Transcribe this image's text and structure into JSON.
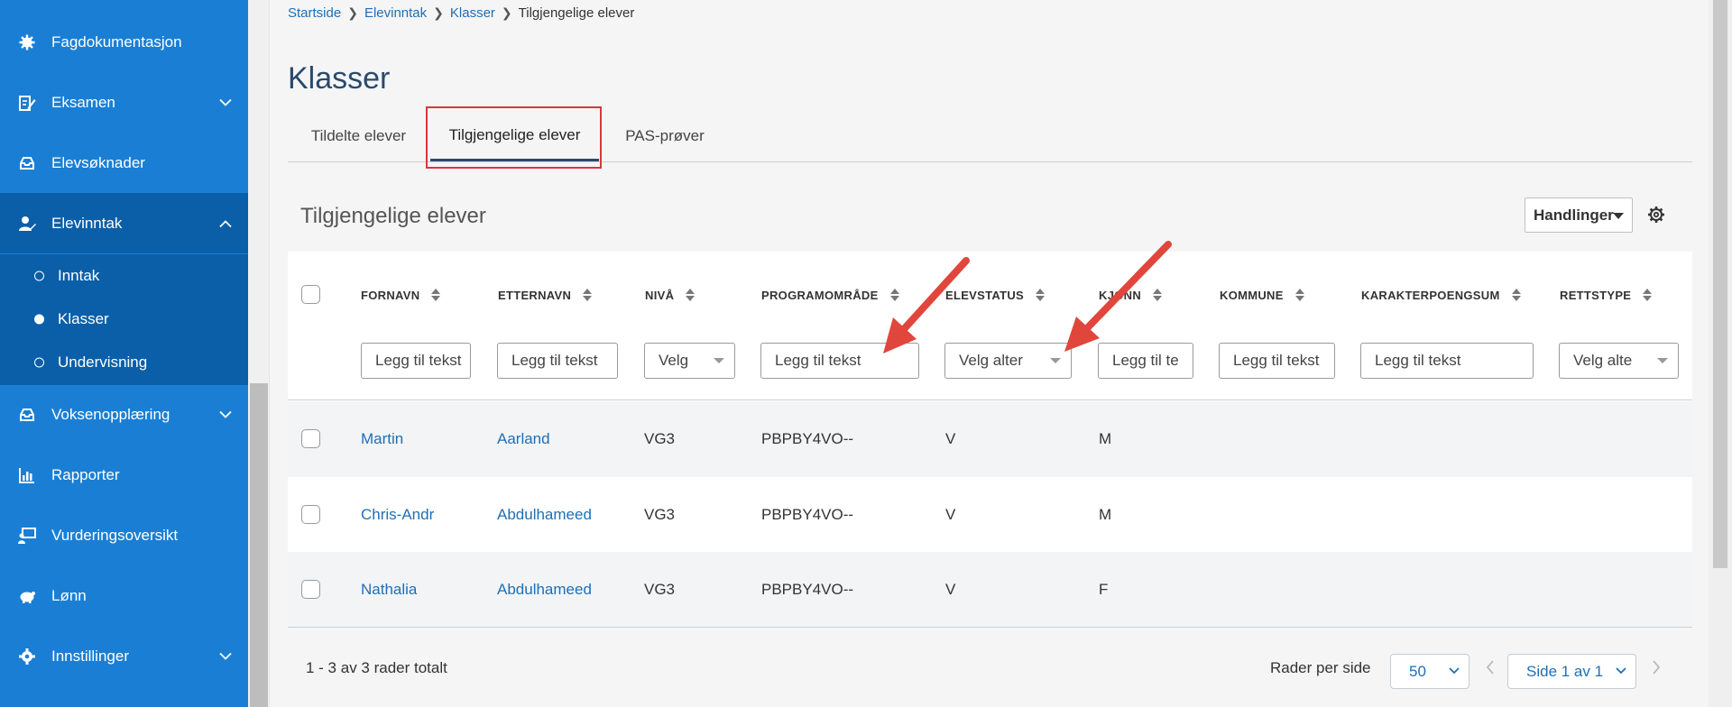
{
  "sidebar": {
    "items": [
      {
        "label": "Fagdokumentasjon",
        "icon": "gear-cog-icon"
      },
      {
        "label": "Eksamen",
        "icon": "edit-document-icon"
      },
      {
        "label": "Elevsøknader",
        "icon": "inbox-icon"
      },
      {
        "label": "Elevinntak",
        "icon": "user-edit-icon"
      },
      {
        "label": "Voksenopplæring",
        "icon": "inbox-icon"
      },
      {
        "label": "Rapporter",
        "icon": "bar-chart-icon"
      },
      {
        "label": "Vurderingsoversikt",
        "icon": "presentation-icon"
      },
      {
        "label": "Lønn",
        "icon": "piggy-bank-icon"
      },
      {
        "label": "Innstillinger",
        "icon": "settings-icon"
      }
    ],
    "subitems": [
      {
        "label": "Inntak"
      },
      {
        "label": "Klasser"
      },
      {
        "label": "Undervisning"
      }
    ]
  },
  "breadcrumb": [
    "Startside",
    "Elevinntak",
    "Klasser",
    "Tilgjengelige elever"
  ],
  "page_title": "Klasser",
  "tabs": [
    {
      "label": "Tildelte elever"
    },
    {
      "label": "Tilgjengelige elever"
    },
    {
      "label": "PAS-prøver"
    }
  ],
  "section_title": "Tilgjengelige elever",
  "actions_label": "Handlinger",
  "table": {
    "columns": [
      {
        "label": "FORNAVN",
        "filter": "Legg til tekst"
      },
      {
        "label": "ETTERNAVN",
        "filter": "Legg til tekst"
      },
      {
        "label": "NIVÅ",
        "filter": "Velg"
      },
      {
        "label": "PROGRAMOMRÅDE",
        "filter": "Legg til tekst"
      },
      {
        "label": "ELEVSTATUS",
        "filter": "Velg alter"
      },
      {
        "label": "KJØNN",
        "filter": "Legg til te"
      },
      {
        "label": "KOMMUNE",
        "filter": "Legg til tekst"
      },
      {
        "label": "KARAKTERPOENGSUM",
        "filter": "Legg til tekst"
      },
      {
        "label": "RETTSTYPE",
        "filter": "Velg alte"
      }
    ],
    "rows": [
      {
        "fornavn": "Martin",
        "etternavn": "Aarland",
        "niva": "VG3",
        "program": "PBPBY4VO--",
        "status": "V",
        "kjonn": "M"
      },
      {
        "fornavn": "Chris-Andr",
        "etternavn": "Abdulhameed",
        "niva": "VG3",
        "program": "PBPBY4VO--",
        "status": "V",
        "kjonn": "M"
      },
      {
        "fornavn": "Nathalia",
        "etternavn": "Abdulhameed",
        "niva": "VG3",
        "program": "PBPBY4VO--",
        "status": "V",
        "kjonn": "F"
      }
    ]
  },
  "footer": {
    "total": "1 - 3 av 3 rader totalt",
    "rows_per_page_label": "Rader per side",
    "rows_per_page_value": "50",
    "page_label": "Side 1 av 1"
  },
  "colors": {
    "sidebar": "#1a7fd4",
    "sidebar_active": "#0b5fa8",
    "link": "#1f6fb5",
    "annotation": "#e0463c"
  }
}
